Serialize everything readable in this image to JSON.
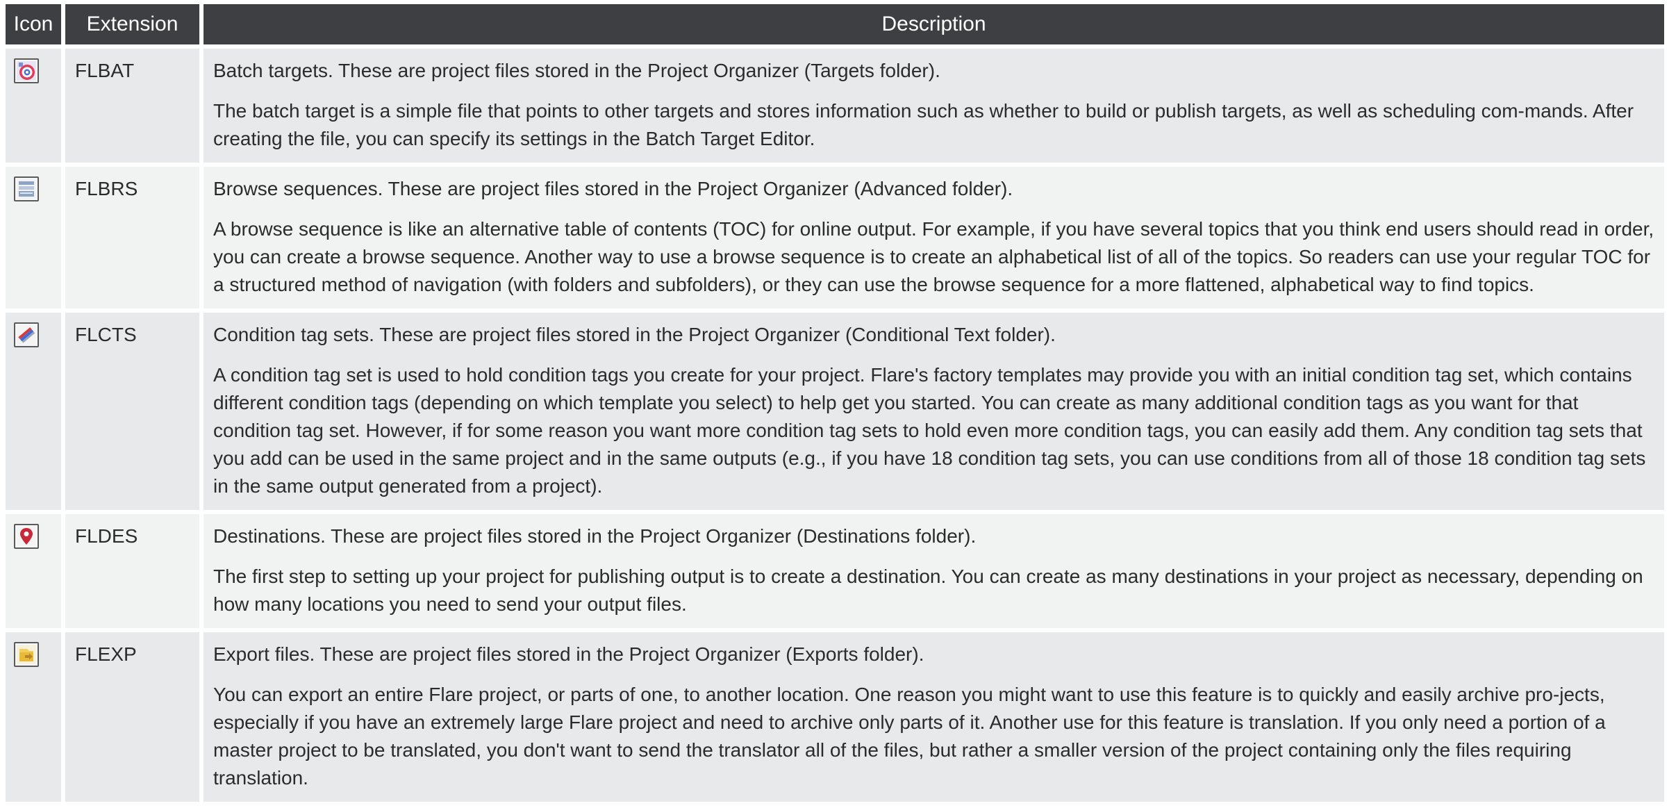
{
  "table": {
    "headers": {
      "icon": "Icon",
      "extension": "Extension",
      "description": "Description"
    },
    "rows": [
      {
        "icon": "batch-target-icon",
        "extension": "FLBAT",
        "summary": "Batch targets. These are project files stored in the Project Organizer (Targets folder).",
        "detail": "The batch target is a simple file that points to other targets and stores information such as whether to build or publish targets, as well as scheduling com-mands. After creating the file, you can specify its settings in the Batch Target Editor."
      },
      {
        "icon": "browse-sequence-icon",
        "extension": "FLBRS",
        "summary": "Browse sequences. These are project files stored in the Project Organizer (Advanced folder).",
        "detail": "A browse sequence is like an alternative table of contents (TOC) for online output. For example, if you have several topics that you think end users should read in order, you can create a browse sequence. Another way to use a browse sequence is to create an alphabetical list of all of the topics. So readers can use your regular TOC for a structured method of navigation (with folders and subfolders), or they can use the browse sequence for a more flattened, alphabetical way to find topics."
      },
      {
        "icon": "condition-tag-set-icon",
        "extension": "FLCTS",
        "summary": "Condition tag sets. These are project files stored in the Project Organizer (Conditional Text folder).",
        "detail": "A condition tag set is used to hold condition tags you create for your project. Flare's factory templates may provide you with an initial condition tag set, which contains different condition tags (depending on which template you select) to help get you started. You can create as many additional condition tags as you want for that condition tag set. However, if for some reason you want more condition tag sets to hold even more condition tags, you can easily add them. Any condition tag sets that you add can be used in the same project and in the same outputs (e.g., if you have 18 condition tag sets, you can use conditions from all of those 18 condition tag sets in the same output generated from a project)."
      },
      {
        "icon": "destination-pin-icon",
        "extension": "FLDES",
        "summary": "Destinations. These are project files stored in the Project Organizer (Destinations folder).",
        "detail": "The first step to setting up your project for publishing output is to create a destination. You can create as many destinations in your project as necessary, depending on how many locations you need to send your output files."
      },
      {
        "icon": "export-file-icon",
        "extension": "FLEXP",
        "summary": "Export files. These are project files stored in the Project Organizer (Exports folder).",
        "detail": "You can export an entire Flare project, or parts of one, to another location. One reason you might want to use this feature is to quickly and easily archive pro-jects, especially if you have an extremely large Flare project and need to archive only parts of it. Another use for this feature is translation. If you only need a portion of a master project to be translated, you don't want to send the translator all of the files, but rather a smaller version of the project containing only the files requiring translation."
      }
    ]
  }
}
